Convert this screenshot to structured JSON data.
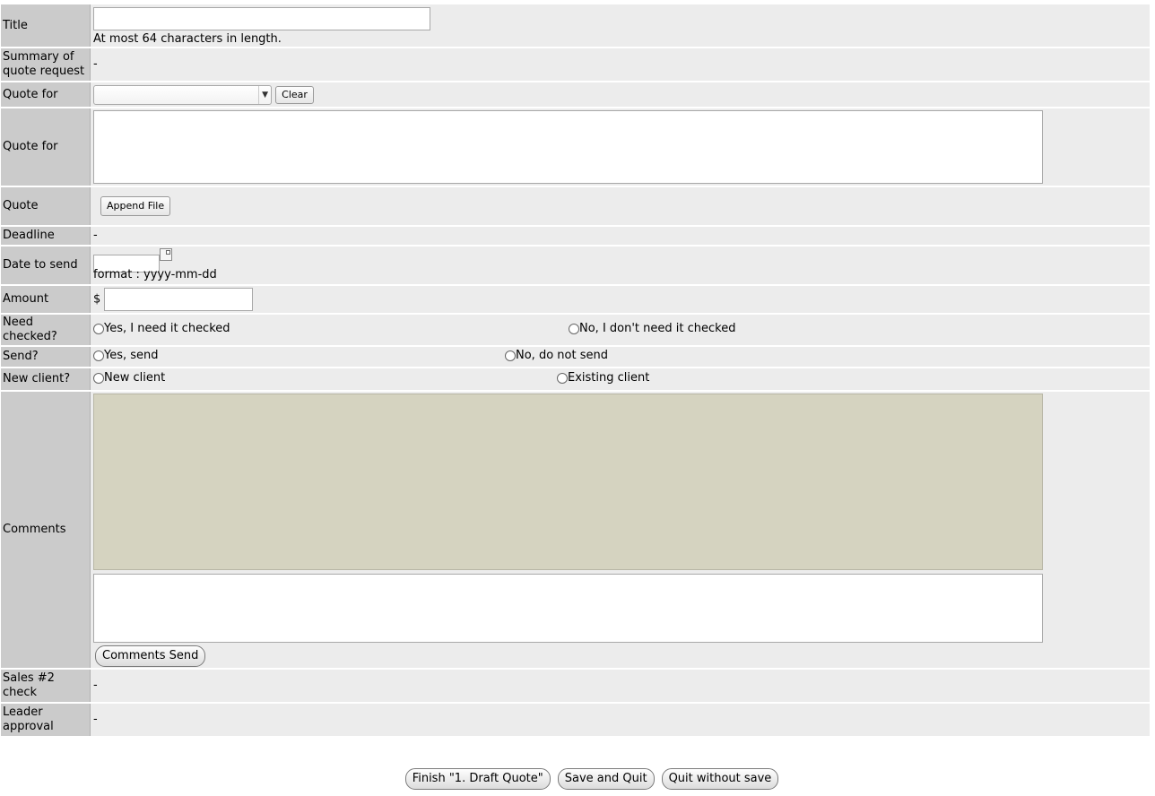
{
  "form": {
    "title": {
      "label": "Title",
      "value": "",
      "hint": "At most 64 characters in length."
    },
    "summary": {
      "label": "Summary of quote request",
      "value": "-"
    },
    "quote_for_select": {
      "label": "Quote for",
      "selected": "",
      "clear_label": "Clear"
    },
    "quote_for_text": {
      "label": "Quote for",
      "value": ""
    },
    "quote": {
      "label": "Quote",
      "append_label": "Append File"
    },
    "deadline": {
      "label": "Deadline",
      "value": "-"
    },
    "date_to_send": {
      "label": "Date to send",
      "value": "",
      "format_hint": "format : yyyy-mm-dd"
    },
    "amount": {
      "label": "Amount",
      "currency": "$",
      "value": ""
    },
    "need_checked": {
      "label": "Need checked?",
      "option_yes": "Yes, I need it checked",
      "option_no": "No, I don't need it checked"
    },
    "send": {
      "label": "Send?",
      "option_yes": "Yes, send",
      "option_no": "No, do not send"
    },
    "new_client": {
      "label": "New client?",
      "option_new": "New client",
      "option_existing": "Existing client"
    },
    "comments": {
      "label": "Comments",
      "input_value": "",
      "send_label": "Comments Send"
    },
    "sales2_check": {
      "label": "Sales #2 check",
      "value": "-"
    },
    "leader_approval": {
      "label": "Leader approval",
      "value": "-"
    }
  },
  "actions": {
    "finish_label": "Finish \"1. Draft Quote\"",
    "save_quit_label": "Save and Quit",
    "quit_nosave_label": "Quit without save"
  },
  "colors": {
    "label_bg": "#cbcbcb",
    "value_bg": "#ececec",
    "comments_log_bg": "#d5d3c0"
  },
  "icons": {
    "select_arrow": "chevron-down-icon",
    "calendar": "calendar-icon",
    "radio": "radio-icon"
  }
}
